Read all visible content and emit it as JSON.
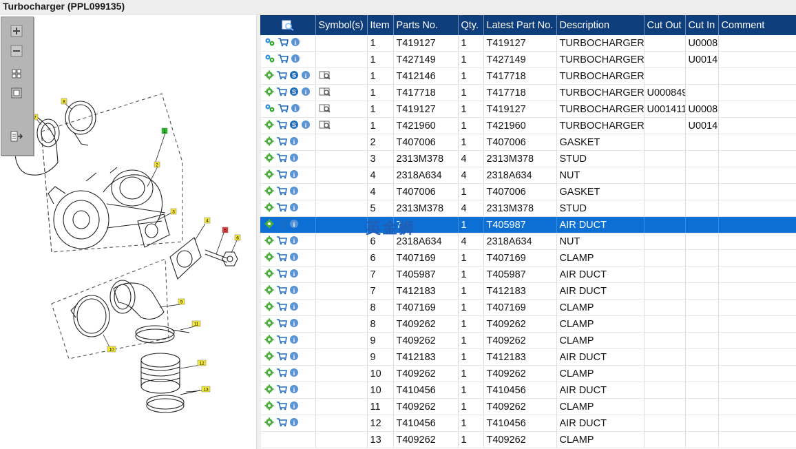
{
  "window": {
    "title": "Turbocharger (PPL099135)"
  },
  "toolbar": {
    "icons": [
      "zoom-in-icon",
      "zoom-out-icon",
      "fit-page-icon",
      "fit-width-icon",
      "export-icon"
    ]
  },
  "diagram": {
    "callouts": [
      {
        "label": "1",
        "color": "#22c322"
      },
      {
        "label": "2",
        "color": "#f5e93a"
      },
      {
        "label": "3",
        "color": "#f5e93a"
      },
      {
        "label": "4",
        "color": "#f5e93a"
      },
      {
        "label": "5",
        "color": "#ee4040"
      },
      {
        "label": "6",
        "color": "#f5e93a"
      },
      {
        "label": "7",
        "color": "#f5e93a"
      },
      {
        "label": "8",
        "color": "#f5e93a"
      },
      {
        "label": "9",
        "color": "#f5e93a"
      },
      {
        "label": "10",
        "color": "#f5e93a"
      },
      {
        "label": "11",
        "color": "#f5e93a"
      },
      {
        "label": "12",
        "color": "#f5e93a"
      },
      {
        "label": "13",
        "color": "#f5e93a"
      }
    ]
  },
  "table": {
    "headers": [
      "",
      "Symbol(s)",
      "Item",
      "Parts No.",
      "Qty.",
      "Latest Part No.",
      "Description",
      "Cut Out",
      "Cut In",
      "Comment"
    ],
    "rows": [
      {
        "icons": [
          "parts-icon",
          "cart-icon",
          "info-icon"
        ],
        "symbols": "",
        "item": "1",
        "part": "T419127",
        "qty": "1",
        "latest": "T419127",
        "desc": "TURBOCHARGER",
        "cutout": "",
        "cutin": "U0008",
        "comment": ""
      },
      {
        "icons": [
          "parts-icon",
          "cart-icon",
          "info-icon"
        ],
        "symbols": "",
        "item": "1",
        "part": "T427149",
        "qty": "1",
        "latest": "T427149",
        "desc": "TURBOCHARGER",
        "cutout": "",
        "cutin": "U0014",
        "comment": ""
      },
      {
        "icons": [
          "gear-icon",
          "cart-icon",
          "service-icon",
          "info-icon"
        ],
        "symbols": "book",
        "item": "1",
        "part": "T412146",
        "qty": "1",
        "latest": "T417718",
        "desc": "TURBOCHARGER",
        "cutout": "",
        "cutin": "",
        "comment": ""
      },
      {
        "icons": [
          "gear-icon",
          "cart-icon",
          "service-icon",
          "info-icon"
        ],
        "symbols": "book",
        "item": "1",
        "part": "T417718",
        "qty": "1",
        "latest": "T417718",
        "desc": "TURBOCHARGER",
        "cutout": "U000849",
        "cutin": "",
        "comment": ""
      },
      {
        "icons": [
          "parts-icon",
          "cart-icon",
          "info-icon"
        ],
        "symbols": "book",
        "item": "1",
        "part": "T419127",
        "qty": "1",
        "latest": "T419127",
        "desc": "TURBOCHARGER",
        "cutout": "U001411",
        "cutin": "U0008",
        "comment": ""
      },
      {
        "icons": [
          "gear-icon",
          "cart-icon",
          "service-icon",
          "info-icon"
        ],
        "symbols": "book",
        "item": "1",
        "part": "T421960",
        "qty": "1",
        "latest": "T421960",
        "desc": "TURBOCHARGER",
        "cutout": "",
        "cutin": "U0014",
        "comment": ""
      },
      {
        "icons": [
          "gear-icon",
          "cart-icon",
          "info-icon"
        ],
        "symbols": "",
        "item": "2",
        "part": "T407006",
        "qty": "1",
        "latest": "T407006",
        "desc": "GASKET",
        "cutout": "",
        "cutin": "",
        "comment": ""
      },
      {
        "icons": [
          "gear-icon",
          "cart-icon",
          "info-icon"
        ],
        "symbols": "",
        "item": "3",
        "part": "2313M378",
        "qty": "4",
        "latest": "2313M378",
        "desc": "STUD",
        "cutout": "",
        "cutin": "",
        "comment": ""
      },
      {
        "icons": [
          "gear-icon",
          "cart-icon",
          "info-icon"
        ],
        "symbols": "",
        "item": "4",
        "part": "2318A634",
        "qty": "4",
        "latest": "2318A634",
        "desc": "NUT",
        "cutout": "",
        "cutin": "",
        "comment": ""
      },
      {
        "icons": [
          "gear-icon",
          "cart-icon",
          "info-icon"
        ],
        "symbols": "",
        "item": "4",
        "part": "T407006",
        "qty": "1",
        "latest": "T407006",
        "desc": "GASKET",
        "cutout": "",
        "cutin": "",
        "comment": ""
      },
      {
        "icons": [
          "gear-icon",
          "cart-icon",
          "info-icon"
        ],
        "symbols": "",
        "item": "5",
        "part": "2313M378",
        "qty": "4",
        "latest": "2313M378",
        "desc": "STUD",
        "cutout": "",
        "cutin": "",
        "comment": ""
      },
      {
        "icons": [
          "gear-icon",
          "cart-icon",
          "info-icon"
        ],
        "symbols": "",
        "item": "",
        "part": "7",
        "qty": "1",
        "latest": "T405987",
        "desc": "AIR DUCT",
        "cutout": "",
        "cutin": "",
        "comment": "",
        "selected": true
      },
      {
        "icons": [
          "gear-icon",
          "cart-icon",
          "info-icon"
        ],
        "symbols": "",
        "item": "6",
        "part": "2318A634",
        "qty": "4",
        "latest": "2318A634",
        "desc": "NUT",
        "cutout": "",
        "cutin": "",
        "comment": ""
      },
      {
        "icons": [
          "gear-icon",
          "cart-icon",
          "info-icon"
        ],
        "symbols": "",
        "item": "6",
        "part": "T407169",
        "qty": "1",
        "latest": "T407169",
        "desc": "CLAMP",
        "cutout": "",
        "cutin": "",
        "comment": ""
      },
      {
        "icons": [
          "gear-icon",
          "cart-icon",
          "info-icon"
        ],
        "symbols": "",
        "item": "7",
        "part": "T405987",
        "qty": "1",
        "latest": "T405987",
        "desc": "AIR DUCT",
        "cutout": "",
        "cutin": "",
        "comment": ""
      },
      {
        "icons": [
          "gear-icon",
          "cart-icon",
          "info-icon"
        ],
        "symbols": "",
        "item": "7",
        "part": "T412183",
        "qty": "1",
        "latest": "T412183",
        "desc": "AIR DUCT",
        "cutout": "",
        "cutin": "",
        "comment": ""
      },
      {
        "icons": [
          "gear-icon",
          "cart-icon",
          "info-icon"
        ],
        "symbols": "",
        "item": "8",
        "part": "T407169",
        "qty": "1",
        "latest": "T407169",
        "desc": "CLAMP",
        "cutout": "",
        "cutin": "",
        "comment": ""
      },
      {
        "icons": [
          "gear-icon",
          "cart-icon",
          "info-icon"
        ],
        "symbols": "",
        "item": "8",
        "part": "T409262",
        "qty": "1",
        "latest": "T409262",
        "desc": "CLAMP",
        "cutout": "",
        "cutin": "",
        "comment": ""
      },
      {
        "icons": [
          "gear-icon",
          "cart-icon",
          "info-icon"
        ],
        "symbols": "",
        "item": "9",
        "part": "T409262",
        "qty": "1",
        "latest": "T409262",
        "desc": "CLAMP",
        "cutout": "",
        "cutin": "",
        "comment": ""
      },
      {
        "icons": [
          "gear-icon",
          "cart-icon",
          "info-icon"
        ],
        "symbols": "",
        "item": "9",
        "part": "T412183",
        "qty": "1",
        "latest": "T412183",
        "desc": "AIR DUCT",
        "cutout": "",
        "cutin": "",
        "comment": ""
      },
      {
        "icons": [
          "gear-icon",
          "cart-icon",
          "info-icon"
        ],
        "symbols": "",
        "item": "10",
        "part": "T409262",
        "qty": "1",
        "latest": "T409262",
        "desc": "CLAMP",
        "cutout": "",
        "cutin": "",
        "comment": ""
      },
      {
        "icons": [
          "gear-icon",
          "cart-icon",
          "info-icon"
        ],
        "symbols": "",
        "item": "10",
        "part": "T410456",
        "qty": "1",
        "latest": "T410456",
        "desc": "AIR DUCT",
        "cutout": "",
        "cutin": "",
        "comment": ""
      },
      {
        "icons": [
          "gear-icon",
          "cart-icon",
          "info-icon"
        ],
        "symbols": "",
        "item": "11",
        "part": "T409262",
        "qty": "1",
        "latest": "T409262",
        "desc": "CLAMP",
        "cutout": "",
        "cutin": "",
        "comment": ""
      },
      {
        "icons": [
          "gear-icon",
          "cart-icon",
          "info-icon"
        ],
        "symbols": "",
        "item": "12",
        "part": "T410456",
        "qty": "1",
        "latest": "T410456",
        "desc": "AIR DUCT",
        "cutout": "",
        "cutin": "",
        "comment": ""
      },
      {
        "icons": [],
        "symbols": "",
        "item": "13",
        "part": "T409262",
        "qty": "1",
        "latest": "T409262",
        "desc": "CLAMP",
        "cutout": "",
        "cutin": "",
        "comment": ""
      }
    ]
  },
  "watermark": {
    "text": "英金狮"
  },
  "colors": {
    "header_bg": "#0f3e7d",
    "selection": "#0d6fd4",
    "titlebar": "#eeeeee"
  }
}
